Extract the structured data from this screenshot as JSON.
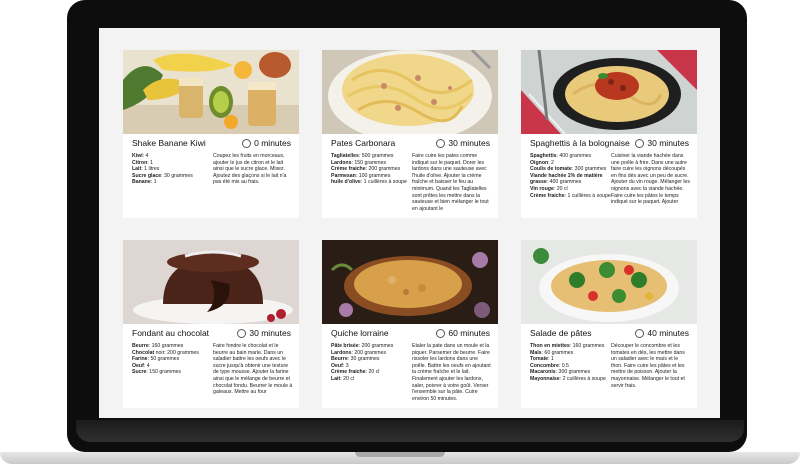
{
  "recipes": [
    {
      "title": "Shake Banane Kiwi",
      "time": "0 minutes",
      "ingredients": [
        {
          "name": "Kiwi",
          "qty": ": 4"
        },
        {
          "name": "Citron",
          "qty": ": 1"
        },
        {
          "name": "Lait",
          "qty": ": 1 litres"
        },
        {
          "name": "Sucre glace",
          "qty": ": 30 grammes"
        },
        {
          "name": "Banane",
          "qty": ": 1"
        }
      ],
      "steps": "Coupez les fruits en morceaux, ajouter le jus de citron et le lait ainsi que le sucre glace. Mixez. Ajoutez des glaçons si le lait n'a pas été mis au frais."
    },
    {
      "title": "Pates Carbonara",
      "time": "30 minutes",
      "ingredients": [
        {
          "name": "Tagliatelles",
          "qty": ": 500 grammes"
        },
        {
          "name": "Lardons",
          "qty": ": 150 grammes"
        },
        {
          "name": "Crème fraiche",
          "qty": ": 200 grammes"
        },
        {
          "name": "Parmesan",
          "qty": ": 100 grammes"
        },
        {
          "name": "huile d'olive",
          "qty": ": 1 cuillères à soupe"
        }
      ],
      "steps": "Faire cuire les pates comme indiqué sur le paquet. Dorer les lardons dans une sauteuse avec l'huile d'olive. Ajouter la crème fraîche et baisser le feu au minimum. Quand les Tagliatelles sont prêtes les mettre dans la sauteuse et bien mélanger le tout en ajoutant le"
    },
    {
      "title": "Spaghettis à la bolognaise",
      "time": "30 minutes",
      "ingredients": [
        {
          "name": "Spaghettis",
          "qty": ": 400 grammes"
        },
        {
          "name": "Oignon",
          "qty": ": 2"
        },
        {
          "name": "Coulis de tomate",
          "qty": ": 300 grammes"
        },
        {
          "name": "Viande hachée 1% de matière grasse",
          "qty": ": 400 grammes"
        },
        {
          "name": "Vin rouge",
          "qty": ": 20 cl"
        },
        {
          "name": "Crème fraiche",
          "qty": ": 1 cuillères à soupe"
        }
      ],
      "steps": "Cuisiner la viande hachée dans une poêle à frire. Dans une autre faire cuire les oignons découpés en fins dés avec un peu de sucre. Ajouter du vin rouge. Mélanger les oignons avec la viande hachée. Faire cuire les pâtes le temps indiqué sur le paquet. Ajouter"
    },
    {
      "title": "Fondant au chocolat",
      "time": "30 minutes",
      "ingredients": [
        {
          "name": "Beurre",
          "qty": ": 160 grammes"
        },
        {
          "name": "Chocolat",
          "qty": " noir: 200 grammes"
        },
        {
          "name": "Farine",
          "qty": ": 50 grammes"
        },
        {
          "name": "Oeuf",
          "qty": ": 4"
        },
        {
          "name": "Sucre",
          "qty": ": 150 grammes"
        }
      ],
      "steps": "Faire fondre le chocolat et le beurre au bain marie. Dans un saladier battre les oeufs avec le sucre jusqu'à obtenir une texture de type mousse. Ajouter la farine ainsi que le mélange de beurre et chocolat fondu. Beurrer le moule à gateaux. Mettre au four"
    },
    {
      "title": "Quiche lorraine",
      "time": "60 minutes",
      "ingredients": [
        {
          "name": "Pâte brisée",
          "qty": ": 200 grammes"
        },
        {
          "name": "Lardons",
          "qty": ": 200 grammes"
        },
        {
          "name": "Beurre",
          "qty": ": 30 grammes"
        },
        {
          "name": "Oeuf",
          "qty": ": 3"
        },
        {
          "name": "Crème fraiche",
          "qty": ": 20 cl"
        },
        {
          "name": "Lait",
          "qty": ": 20 cl"
        }
      ],
      "steps": "Etaler la pate dans un moule et la piquer. Parsemer de beurre. Faire rissoler les lardons dans une poêle. Battre les oeufs en ajoutant la crème fraîche et le lait. Finalement ajouter les lardons, saler, poivrer à votre goût. Verser l'ensemble sur la pâte. Cuire environ 50 minutes."
    },
    {
      "title": "Salade de pâtes",
      "time": "40 minutes",
      "ingredients": [
        {
          "name": "Thon en miettes",
          "qty": ": 160 grammes"
        },
        {
          "name": "Maïs",
          "qty": ": 60 grammes"
        },
        {
          "name": "Tomate",
          "qty": ": 1"
        },
        {
          "name": "Concombre",
          "qty": ": 0.5"
        },
        {
          "name": "Macaronis",
          "qty": ": 300 grammes"
        },
        {
          "name": "Mayonnaise",
          "qty": ": 2 cuillères à soupe"
        }
      ],
      "steps": "Découper le concombre et les tomates en dés, les mettre dans un saladier avec le maïs et le thon. Faire cuire les pâtes et les mettre de poisson. Ajouter la mayonnaise. Mélanger le tout et servir frais."
    }
  ]
}
